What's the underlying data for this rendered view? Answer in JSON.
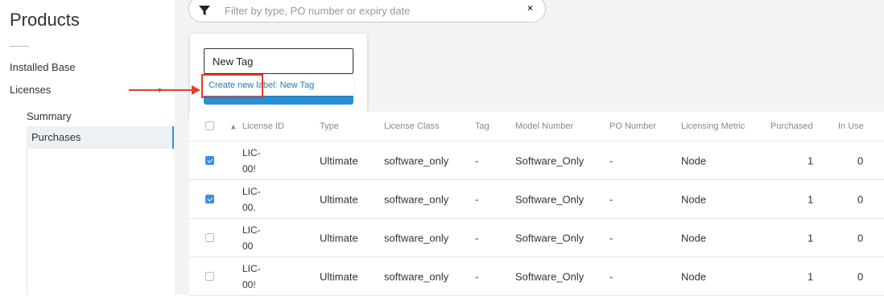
{
  "sidebar": {
    "title": "Products",
    "items": [
      {
        "label": "Installed Base"
      },
      {
        "label": "Licenses"
      }
    ],
    "sub_items": [
      {
        "label": "Summary"
      },
      {
        "label": "Purchases"
      }
    ]
  },
  "filter": {
    "placeholder": "Filter by type, PO number or expiry date",
    "clear": "×"
  },
  "tag_popup": {
    "input_value": "New Tag",
    "suggestion": "Create new label: New Tag"
  },
  "table": {
    "columns": [
      "License ID",
      "Type",
      "License Class",
      "Tag",
      "Model Number",
      "PO Number",
      "Licensing Metric",
      "Purchased",
      "In Use"
    ],
    "rows": [
      {
        "checked": true,
        "id_line1": "LIC-",
        "id_line2": "00!",
        "type": "Ultimate",
        "class": "software_only",
        "tag": "-",
        "model": "Software_Only",
        "po": "-",
        "metric": "Node",
        "purchased": "1",
        "in_use": "0"
      },
      {
        "checked": true,
        "id_line1": "LIC-",
        "id_line2": "00.",
        "type": "Ultimate",
        "class": "software_only",
        "tag": "-",
        "model": "Software_Only",
        "po": "-",
        "metric": "Node",
        "purchased": "1",
        "in_use": "0"
      },
      {
        "checked": false,
        "id_line1": "LIC-",
        "id_line2": "00",
        "type": "Ultimate",
        "class": "software_only",
        "tag": "-",
        "model": "Software_Only",
        "po": "-",
        "metric": "Node",
        "purchased": "1",
        "in_use": "0"
      },
      {
        "checked": false,
        "id_line1": "LIC-",
        "id_line2": "00!",
        "type": "Ultimate",
        "class": "software_only",
        "tag": "-",
        "model": "Software_Only",
        "po": "-",
        "metric": "Node",
        "purchased": "1",
        "in_use": "0"
      }
    ]
  },
  "colors": {
    "accent": "#2b8fd6",
    "annotation": "#e0402a",
    "link": "#2a7ab8"
  }
}
